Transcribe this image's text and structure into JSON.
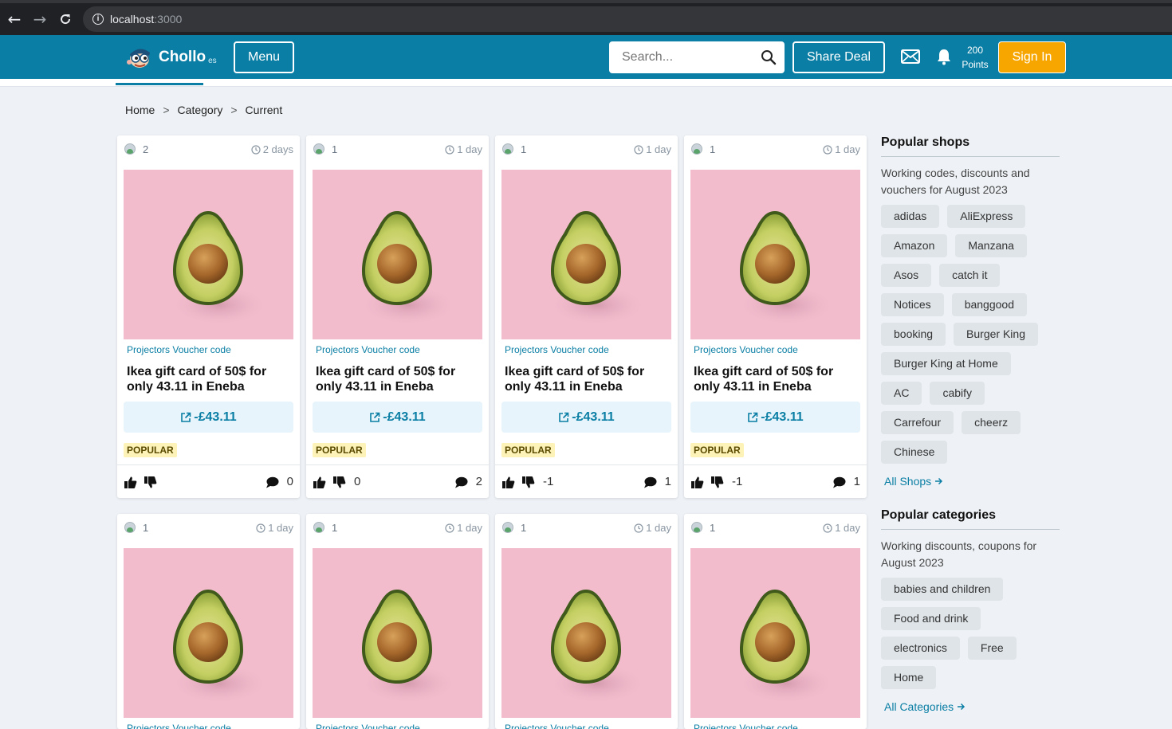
{
  "browser": {
    "url_host": "localhost",
    "url_port": ":3000"
  },
  "header": {
    "logo_text": "Chollo",
    "logo_suffix": "es",
    "menu_label": "Menu",
    "search_placeholder": "Search...",
    "share_label": "Share Deal",
    "points_value": "200",
    "points_label": "Points",
    "signin_label": "Sign In"
  },
  "breadcrumb": {
    "home": "Home",
    "category": "Category",
    "current": "Current",
    "separator": ">"
  },
  "deals": [
    {
      "votes": "2",
      "time": "2 days",
      "category": "Projectors Voucher code",
      "title": "Ikea gift card of 50$ for only 43.11 in Eneba",
      "price": "-£43.11",
      "badge": "POPULAR",
      "score": "",
      "comments": "0"
    },
    {
      "votes": "1",
      "time": "1 day",
      "category": "Projectors Voucher code",
      "title": "Ikea gift card of 50$ for only 43.11 in Eneba",
      "price": "-£43.11",
      "badge": "POPULAR",
      "score": "0",
      "comments": "2"
    },
    {
      "votes": "1",
      "time": "1 day",
      "category": "Projectors Voucher code",
      "title": "Ikea gift card of 50$ for only 43.11 in Eneba",
      "price": "-£43.11",
      "badge": "POPULAR",
      "score": "-1",
      "comments": "1"
    },
    {
      "votes": "1",
      "time": "1 day",
      "category": "Projectors Voucher code",
      "title": "Ikea gift card of 50$ for only 43.11 in Eneba",
      "price": "-£43.11",
      "badge": "POPULAR",
      "score": "-1",
      "comments": "1"
    },
    {
      "votes": "1",
      "time": "1 day",
      "category": "Projectors Voucher code"
    },
    {
      "votes": "1",
      "time": "1 day",
      "category": "Projectors Voucher code"
    },
    {
      "votes": "1",
      "time": "1 day",
      "category": "Projectors Voucher code"
    },
    {
      "votes": "1",
      "time": "1 day",
      "category": "Projectors Voucher code"
    }
  ],
  "sidebar": {
    "shops_title": "Popular shops",
    "shops_desc": "Working codes, discounts and vouchers for August 2023",
    "shops": [
      "adidas",
      "AliExpress",
      "Amazon",
      "Manzana",
      "Asos",
      "catch it",
      "Notices",
      "banggood",
      "booking",
      "Burger King",
      "Burger King at Home",
      "AC",
      "cabify",
      "Carrefour",
      "cheerz",
      "Chinese"
    ],
    "all_shops": "All Shops",
    "categories_title": "Popular categories",
    "categories_desc": "Working discounts, coupons for August 2023",
    "categories": [
      "babies and children",
      "Food and drink",
      "electronics",
      "Free",
      "Home"
    ],
    "all_categories": "All Categories"
  },
  "colors": {
    "brand": "#0a7ea4",
    "signin": "#f7a600",
    "deal_image_bg": "#f2bccd",
    "popular_badge": "#fdf3b8"
  },
  "icons": [
    "back-arrow-icon",
    "forward-arrow-icon",
    "reload-icon",
    "info-icon",
    "search-icon",
    "mail-icon",
    "bell-icon",
    "clock-icon",
    "external-link-icon",
    "thumbs-up-icon",
    "thumbs-down-icon",
    "comment-icon",
    "arrow-right-icon"
  ]
}
